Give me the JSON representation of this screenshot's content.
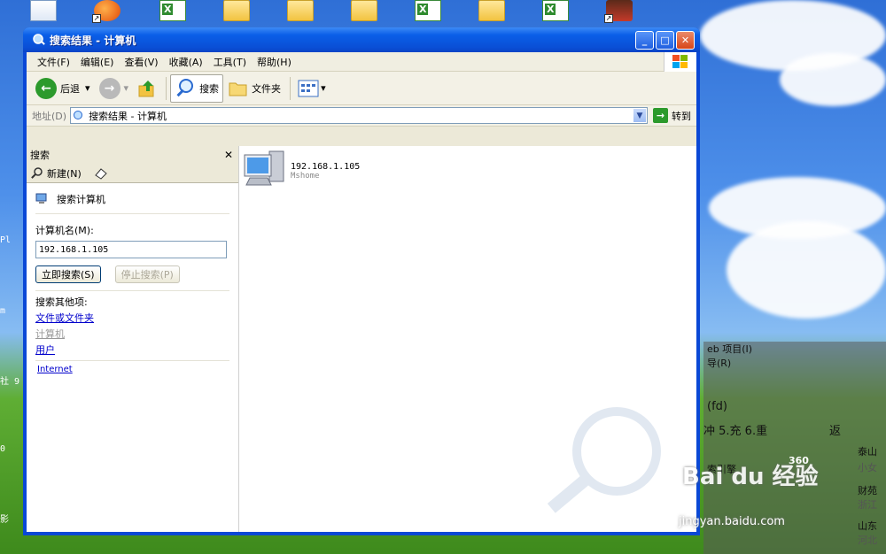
{
  "window": {
    "title": "搜索结果 - 计算机",
    "min_label": "_",
    "max_label": "□",
    "close_label": "✕"
  },
  "menu": {
    "items": [
      "文件(F)",
      "编辑(E)",
      "查看(V)",
      "收藏(A)",
      "工具(T)",
      "帮助(H)"
    ]
  },
  "toolbar": {
    "back_label": "后退",
    "back_dropdown": "▾",
    "search_label": "搜索",
    "folders_label": "文件夹"
  },
  "address": {
    "label": "地址(D)",
    "value": "搜索结果 - 计算机",
    "go_label": "转到"
  },
  "search_pane": {
    "header": "搜索",
    "close": "✕",
    "new_label": "新建(N)",
    "section_title": "搜索计算机",
    "field_label": "计算机名(M):",
    "field_value": "192.168.1.105",
    "search_now": "立即搜索(S)",
    "stop_search": "停止搜索(P)",
    "other_title": "搜索其他项:",
    "link_files": "文件或文件夹",
    "link_computers": "计算机",
    "link_people": "用户",
    "link_internet": "Internet"
  },
  "results": {
    "ip": "192.168.1.105",
    "hostname": "Mshome"
  },
  "overlay": {
    "line1": "eb 项目(I)",
    "line2": "导(R)",
    "line3": "(fd)",
    "line4": "冲 5.充 6.重",
    "line5": "返",
    "line6": "泰山",
    "line7": "财苑",
    "line8": "山东",
    "line9": "索引擎",
    "line10": "360",
    "line11": "小女",
    "line12": "浙江",
    "line13": "河北"
  },
  "watermark": {
    "brand": "Bai du 经验",
    "url": "jingyan.baidu.com"
  },
  "desktop_side_labels": [
    "Pl",
    "m",
    "社 9",
    "0",
    "影"
  ]
}
